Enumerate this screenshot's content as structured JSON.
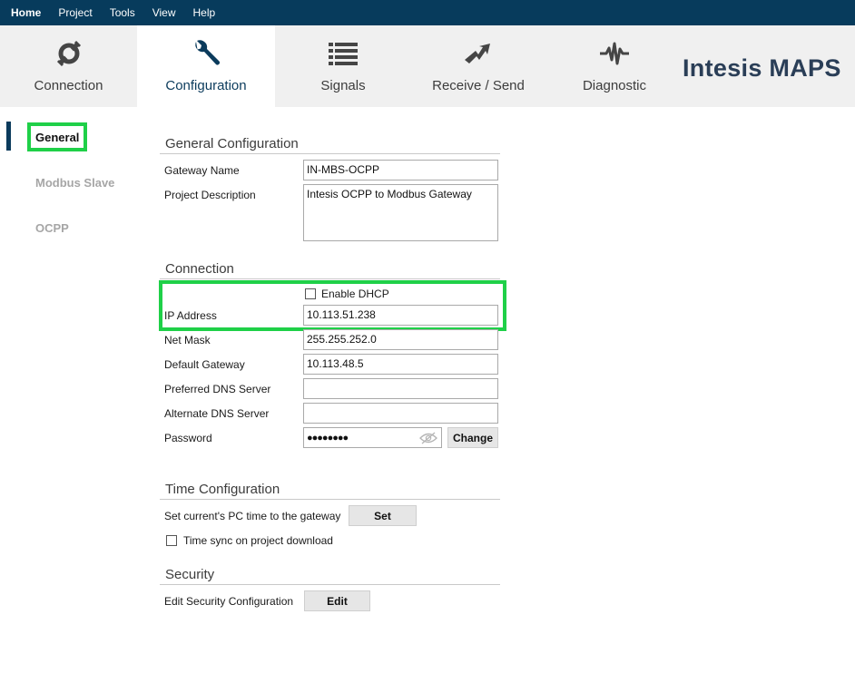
{
  "menu": {
    "items": [
      "Home",
      "Project",
      "Tools",
      "View",
      "Help"
    ]
  },
  "ribbon": {
    "tabs": {
      "connection": {
        "label": "Connection",
        "icon": "plug-icon"
      },
      "configuration": {
        "label": "Configuration",
        "icon": "wrench-icon"
      },
      "signals": {
        "label": "Signals",
        "icon": "list-icon"
      },
      "receive_send": {
        "label": "Receive / Send",
        "icon": "transfer-arrows-icon"
      },
      "diagnostic": {
        "label": "Diagnostic",
        "icon": "pulse-icon"
      }
    },
    "active_tab": "configuration",
    "brand": "Intesis MAPS"
  },
  "sidebar": {
    "items": [
      "General",
      "Modbus Slave",
      "OCPP"
    ],
    "active": "General"
  },
  "general": {
    "title": "General Configuration",
    "gateway_name_label": "Gateway Name",
    "gateway_name_value": "IN-MBS-OCPP",
    "project_description_label": "Project Description",
    "project_description_value": "Intesis OCPP to Modbus Gateway"
  },
  "connection": {
    "title": "Connection",
    "dhcp_label": "Enable DHCP",
    "dhcp_checked": false,
    "ip_label": "IP Address",
    "ip_value": "10.113.51.238",
    "netmask_label": "Net Mask",
    "netmask_value": "255.255.252.0",
    "gateway_label": "Default Gateway",
    "gateway_value": "10.113.48.5",
    "dns1_label": "Preferred DNS Server",
    "dns1_value": "",
    "dns2_label": "Alternate DNS Server",
    "dns2_value": "",
    "password_label": "Password",
    "password_value": "●●●●●●●●",
    "change_label": "Change"
  },
  "time": {
    "title": "Time Configuration",
    "set_time_label": "Set current's PC time to the gateway",
    "set_label": "Set",
    "sync_label": "Time sync on project download",
    "sync_checked": false
  },
  "security": {
    "title": "Security",
    "edit_label": "Edit Security Configuration",
    "edit_button": "Edit"
  },
  "colors": {
    "menubar": "#073b5c",
    "highlight": "#1fd048",
    "brand": "#2a3e57"
  }
}
